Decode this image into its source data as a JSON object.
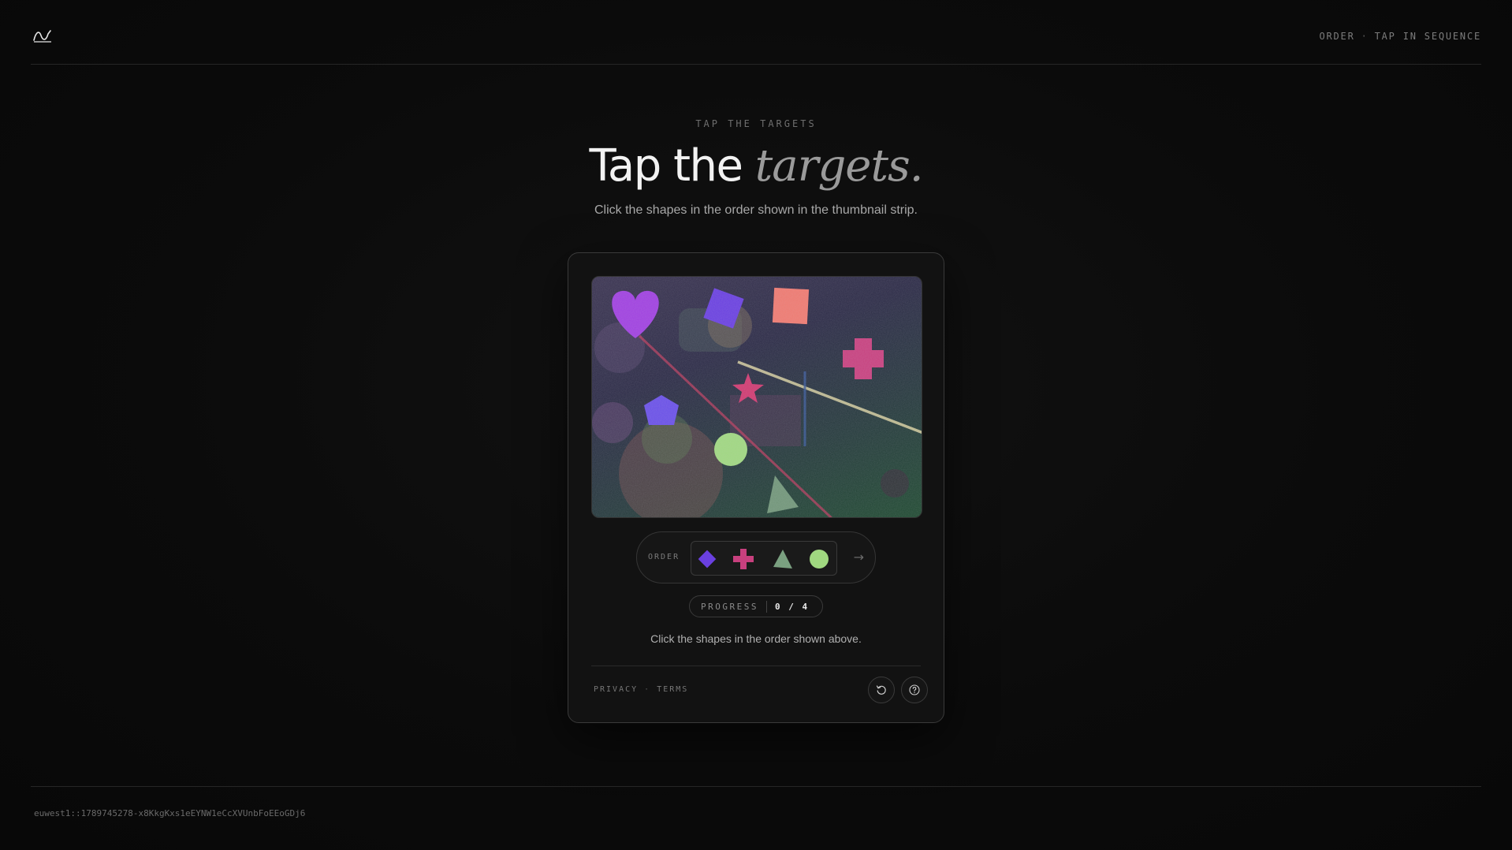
{
  "header": {
    "logo_icon": "wave-logo-icon",
    "right_label": "ORDER",
    "right_separator": "·",
    "right_sublabel": "TAP IN SEQUENCE"
  },
  "hero": {
    "eyebrow": "TAP THE TARGETS",
    "headline_plain": "Tap the ",
    "headline_italic": "targets.",
    "subtitle": "Click the shapes in the order shown in the thumbnail strip."
  },
  "challenge": {
    "canvas_shapes": [
      "heart",
      "diamond",
      "square",
      "cross",
      "star",
      "pentagon",
      "circle",
      "triangle"
    ],
    "order_label": "ORDER",
    "order_sequence": [
      "diamond-icon",
      "cross-icon",
      "triangle-icon",
      "circle-icon"
    ],
    "order_arrow": "→",
    "progress_label": "PROGRESS",
    "progress_value": "0 / 4",
    "instruction": "Click the shapes in the order shown above.",
    "footer_privacy": "PRIVACY",
    "footer_separator": "·",
    "footer_terms": "TERMS",
    "refresh_icon": "refresh-icon",
    "help_icon": "help-icon"
  },
  "footer": {
    "session_id": "euwest1::1789745278-x8KkgKxs1eEYNW1eCcXVUnbFoEEoGDj6"
  },
  "colors": {
    "background": "#0b0b0b",
    "heart": "#9a3fd6",
    "diamond": "#6a3fd8",
    "square": "#e0706a",
    "cross": "#c0407a",
    "star": "#c83a6a",
    "pentagon": "#6a4ae0",
    "circle": "#9ad07a",
    "triangle": "#6a9a7a"
  }
}
